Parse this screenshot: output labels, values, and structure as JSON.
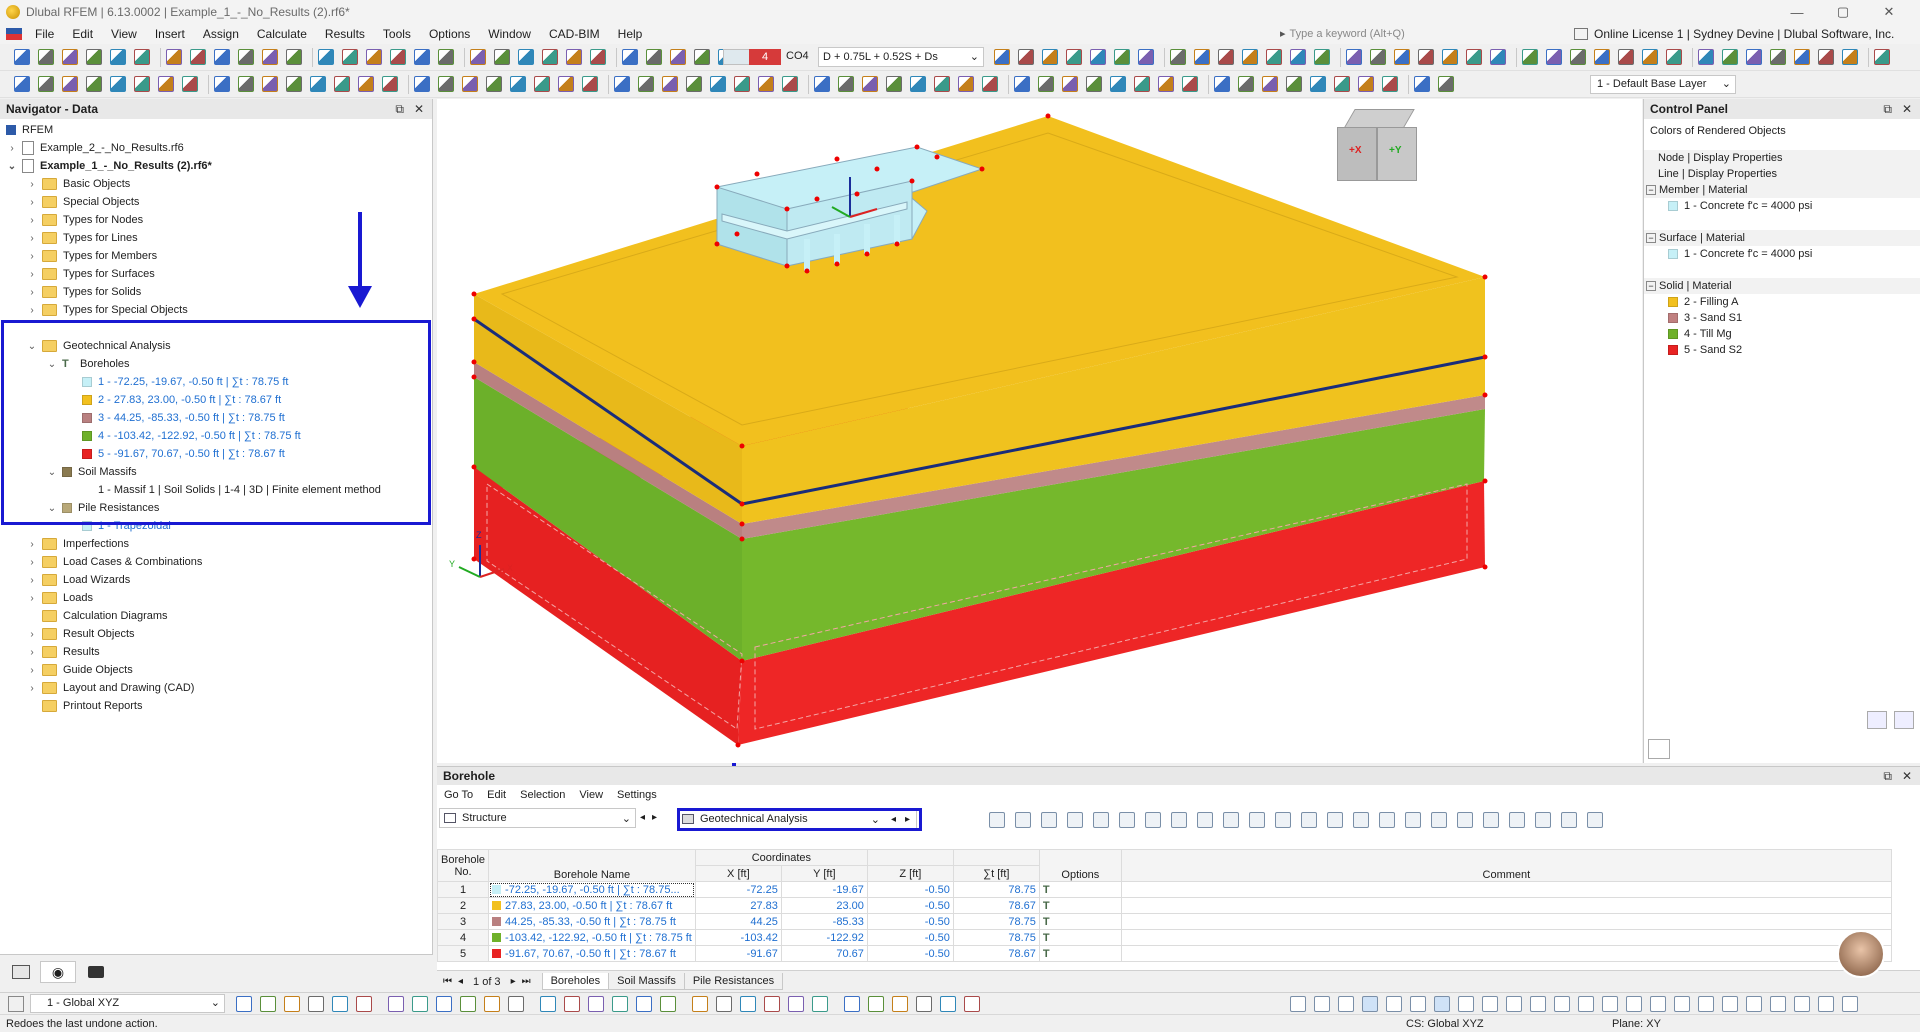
{
  "app": {
    "title": "Dlubal RFEM | 6.13.0002 | Example_1_-_No_Results (2).rf6*",
    "window_controls": [
      "—",
      "▢",
      "✕"
    ]
  },
  "menu": [
    "File",
    "Edit",
    "View",
    "Insert",
    "Assign",
    "Calculate",
    "Results",
    "Tools",
    "Options",
    "Window",
    "CAD-BIM",
    "Help"
  ],
  "search": {
    "placeholder": "Type a keyword (Alt+Q)"
  },
  "license": "Online License 1 | Sydney Devine | Dlubal Software, Inc.",
  "toolbar": {
    "load_case_color": "#d63a3a",
    "load_case_number": "4",
    "load_case_code": "CO4",
    "load_case_formula": "D + 0.75L + 0.52S + Ds",
    "layer": "1 - Default Base Layer"
  },
  "navigator": {
    "title": "Navigator - Data",
    "root": "RFEM",
    "files": [
      "Example_2_-_No_Results.rf6",
      "Example_1_-_No_Results (2).rf6*"
    ],
    "folders_top": [
      "Basic Objects",
      "Special Objects",
      "Types for Nodes",
      "Types for Lines",
      "Types for Members",
      "Types for Surfaces",
      "Types for Solids",
      "Types for Special Objects"
    ],
    "geotech": {
      "label": "Geotechnical Analysis",
      "boreholes_label": "Boreholes",
      "boreholes": [
        {
          "label": "1 - -72.25, -19.67, -0.50 ft | ∑t : 78.75 ft",
          "color": "#c6f0f7"
        },
        {
          "label": "2 - 27.83, 23.00, -0.50 ft | ∑t : 78.67 ft",
          "color": "#f2c01e"
        },
        {
          "label": "3 - 44.25, -85.33, -0.50 ft | ∑t : 78.75 ft",
          "color": "#b98080"
        },
        {
          "label": "4 - -103.42, -122.92, -0.50 ft | ∑t : 78.75 ft",
          "color": "#6fb12a"
        },
        {
          "label": "5 - -91.67, 70.67, -0.50 ft | ∑t : 78.67 ft",
          "color": "#e82323"
        }
      ],
      "soil_massifs_label": "Soil Massifs",
      "soil_massif": "1 - Massif 1 | Soil Solids | 1-4 | 3D | Finite element method",
      "pile_resistances_label": "Pile Resistances",
      "pile_resistance": "1 - Trapezoidal"
    },
    "folders_bottom": [
      "Imperfections",
      "Load Cases & Combinations",
      "Load Wizards",
      "Loads",
      "Calculation Diagrams",
      "Result Objects",
      "Results",
      "Guide Objects",
      "Layout and Drawing (CAD)",
      "Printout Reports"
    ]
  },
  "control_panel": {
    "title": "Control Panel",
    "subtitle": "Colors of Rendered Objects",
    "rows": [
      "Node | Display Properties",
      "Line | Display Properties"
    ],
    "member_group": "Member | Material",
    "member_items": [
      {
        "label": "1 - Concrete f'c = 4000 psi",
        "color": "#c6f0f7"
      }
    ],
    "surface_group": "Surface | Material",
    "surface_items": [
      {
        "label": "1 - Concrete f'c = 4000 psi",
        "color": "#c6f0f7"
      }
    ],
    "solid_group": "Solid | Material",
    "solid_items": [
      {
        "label": "2 - Filling A",
        "color": "#f2c01e"
      },
      {
        "label": "3 - Sand S1",
        "color": "#c08080"
      },
      {
        "label": "4 - Till Mg",
        "color": "#6fb12a"
      },
      {
        "label": "5 - Sand S2",
        "color": "#e82323"
      }
    ]
  },
  "viewcube": {
    "x_label": "+X",
    "y_label": "+Y"
  },
  "axes": {
    "x": "X",
    "y": "Y",
    "z": "Z"
  },
  "table": {
    "title": "Borehole",
    "menu": [
      "Go To",
      "Edit",
      "Selection",
      "View",
      "Settings"
    ],
    "dropdown_left": "Structure",
    "dropdown_right": "Geotechnical Analysis",
    "headers": {
      "no": "Borehole No.",
      "name": "Borehole Name",
      "coords": "Coordinates",
      "x": "X [ft]",
      "y": "Y [ft]",
      "z": "Z [ft]",
      "sum": "∑t [ft]",
      "options": "Options",
      "comment": "Comment"
    },
    "rows": [
      {
        "no": "1",
        "name": "-72.25, -19.67, -0.50 ft | ∑t : 78.75...",
        "color": "#c6f0f7",
        "x": "-72.25",
        "y": "-19.67",
        "z": "-0.50",
        "sum": "78.75"
      },
      {
        "no": "2",
        "name": "27.83, 23.00, -0.50 ft | ∑t : 78.67 ft",
        "color": "#f2c01e",
        "x": "27.83",
        "y": "23.00",
        "z": "-0.50",
        "sum": "78.67"
      },
      {
        "no": "3",
        "name": "44.25, -85.33, -0.50 ft | ∑t : 78.75 ft",
        "color": "#b98080",
        "x": "44.25",
        "y": "-85.33",
        "z": "-0.50",
        "sum": "78.75"
      },
      {
        "no": "4",
        "name": "-103.42, -122.92, -0.50 ft | ∑t : 78.75 ft",
        "color": "#6fb12a",
        "x": "-103.42",
        "y": "-122.92",
        "z": "-0.50",
        "sum": "78.75"
      },
      {
        "no": "5",
        "name": "-91.67, 70.67, -0.50 ft | ∑t : 78.67 ft",
        "color": "#e82323",
        "x": "-91.67",
        "y": "70.67",
        "z": "-0.50",
        "sum": "78.67"
      }
    ],
    "pager": "1 of 3",
    "tabs": [
      "Boreholes",
      "Soil Massifs",
      "Pile Resistances"
    ]
  },
  "bottom": {
    "coord_system": "1 - Global XYZ"
  },
  "status": {
    "message": "Redoes the last undone action.",
    "cs": "CS: Global XYZ",
    "plane": "Plane: XY"
  }
}
